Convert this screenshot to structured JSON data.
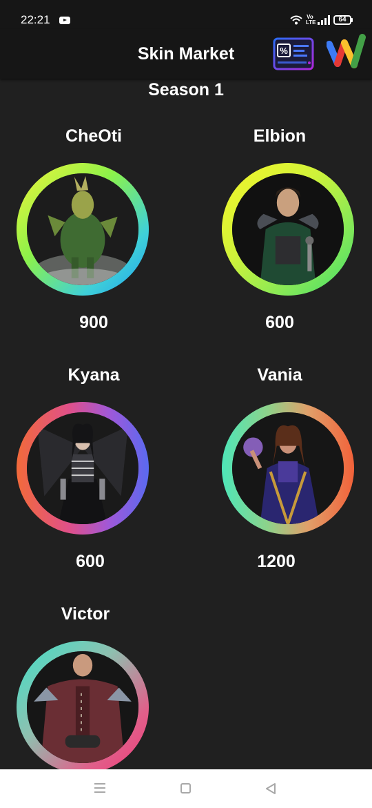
{
  "status_bar": {
    "time": "22:21",
    "battery": "64",
    "network": "Vo LTE"
  },
  "header": {
    "title": "Skin Market"
  },
  "season": {
    "title": "Season 1"
  },
  "skins": [
    {
      "name": "CheOti",
      "price": "900"
    },
    {
      "name": "Elbion",
      "price": "600"
    },
    {
      "name": "Kyana",
      "price": "600"
    },
    {
      "name": "Vania",
      "price": "1200"
    },
    {
      "name": "Victor",
      "price": ""
    }
  ],
  "icons": {
    "coupon": "coupon-icon",
    "wallet": "wallet-icon",
    "youtube": "youtube-icon",
    "wifi": "wifi-icon",
    "signal": "signal-icon",
    "battery": "battery-icon",
    "nav_menu": "menu-icon",
    "nav_home": "home-icon",
    "nav_back": "back-icon"
  },
  "colors": {
    "background": "#202020",
    "header": "#161616",
    "text": "#ffffff",
    "coupon_accent": "#7b2ff7",
    "nav_bar": "#ffffff"
  }
}
